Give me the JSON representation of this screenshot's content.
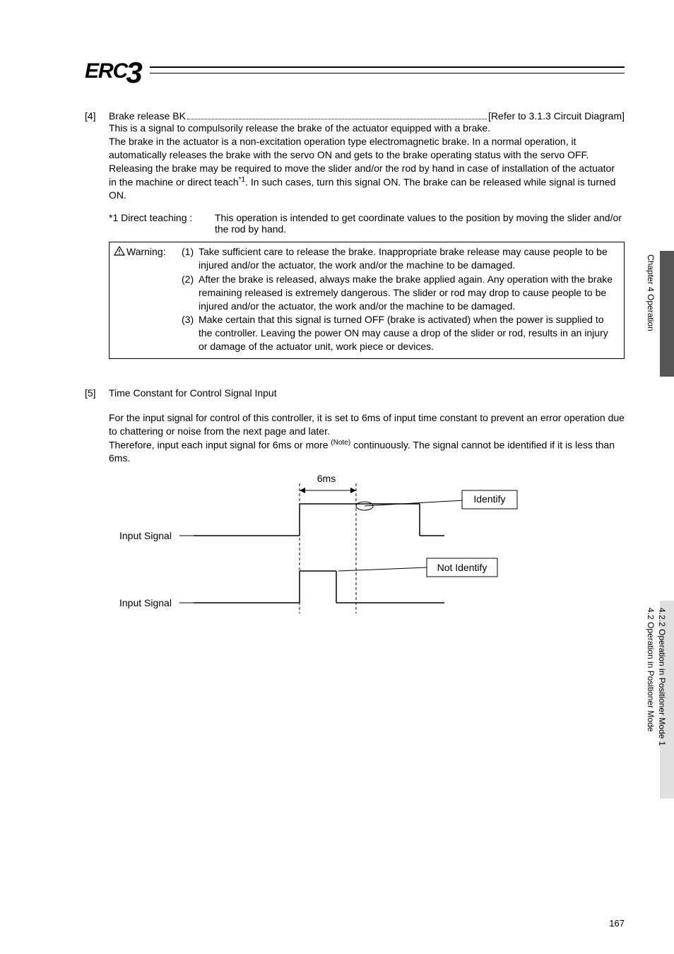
{
  "logo": {
    "text": "ERC",
    "digit": "3"
  },
  "section4": {
    "num": "[4]",
    "title_left": "Brake release BK",
    "title_right": "[Refer to 3.1.3 Circuit Diagram]",
    "body": "This is a signal to compulsorily release the brake of the actuator equipped with a brake.\nThe brake in the actuator is a non-excitation operation type electromagnetic brake. In a normal operation, it automatically releases the brake with the servo ON and gets to the brake operating status with the servo OFF.\nReleasing the brake may be required to move the slider and/or the rod by hand in case of installation of the actuator in the machine or direct teach",
    "body_sup": "*1",
    "body_after": ". In such cases, turn this signal ON. The brake can be released while signal is turned ON.",
    "footnote_label": "*1 Direct teaching :",
    "footnote_body": "This operation is intended to get coordinate values to the position by moving the slider and/or the rod by hand."
  },
  "warning": {
    "label": "Warning:",
    "items": [
      {
        "num": "(1)",
        "text": "Take sufficient care to release the brake. Inappropriate brake release may cause people to be injured and/or the actuator, the work and/or the machine to be damaged."
      },
      {
        "num": "(2)",
        "text": "After the brake is released, always make the brake applied again. Any operation with the brake remaining released is extremely dangerous. The slider or rod may drop to cause people to be injured and/or the actuator, the work and/or the machine to be damaged."
      },
      {
        "num": "(3)",
        "text": "Make certain that this signal is turned OFF (brake is activated) when the power is supplied to the controller. Leaving the power ON may cause a drop of the slider or rod, results in an injury or damage of the actuator unit, work piece or devices."
      }
    ]
  },
  "section5": {
    "num": "[5]",
    "title": "Time Constant for Control Signal Input",
    "body1": "For the input signal for control of this controller, it is set to 6ms of input time constant to prevent an error operation due to chattering or noise from the next page and later.",
    "body2a": "Therefore, input each input signal for 6ms or more ",
    "body2_sup": "(Note)",
    "body2b": " continuously. The signal cannot be identified if it is less than 6ms.",
    "diagram": {
      "label_6ms": "6ms",
      "label_identify": "Identify",
      "label_not_identify": "Not Identify",
      "label_input_signal": "Input Signal"
    }
  },
  "side": {
    "chapter": "Chapter 4 Operation",
    "section_outer": "4.2 Operation in Positioner Mode",
    "section_inner": "4.2.2 Operation in Positioner Mode 1"
  },
  "page_number": "167"
}
